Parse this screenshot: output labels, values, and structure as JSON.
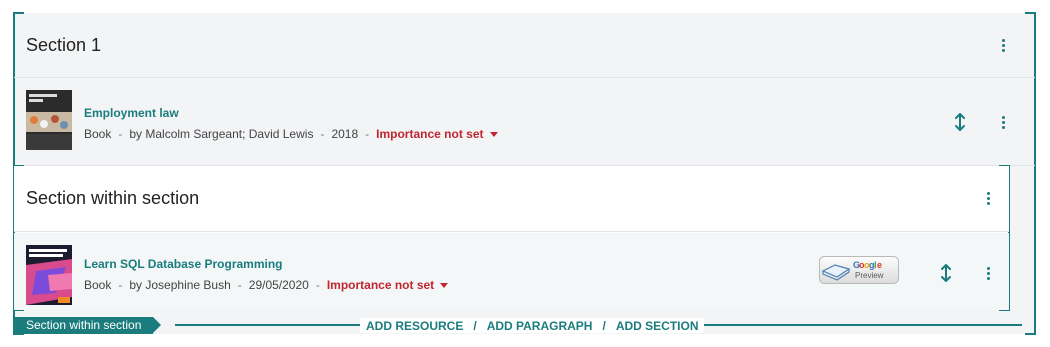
{
  "section": {
    "title": "Section 1",
    "resource": {
      "title": "Employment law",
      "type": "Book",
      "sep": "-",
      "authors": "by Malcolm Sargeant; David Lewis",
      "year": "2018",
      "importance": "Importance not set",
      "cover_text": "Employment Law"
    }
  },
  "subsection": {
    "title": "Section within section",
    "tag": "Section within section",
    "resource": {
      "title": "Learn SQL Database Programming",
      "type": "Book",
      "sep": "-",
      "authors": "by Josephine Bush",
      "date": "29/05/2020",
      "importance": "Importance not set",
      "cover_text": "SQL Database Programming",
      "preview_label": "Google Preview"
    }
  },
  "actions": {
    "add_resource": "ADD RESOURCE",
    "add_paragraph": "ADD PARAGRAPH",
    "add_section": "ADD SECTION",
    "slash": "/"
  },
  "icons": {
    "kebab": "kebab-menu-icon",
    "move": "move-vertical-icon",
    "caret": "caret-down-icon"
  },
  "colors": {
    "accent": "#1b7c7e",
    "importance": "#c0262d",
    "panel": "#f3f4f6"
  }
}
